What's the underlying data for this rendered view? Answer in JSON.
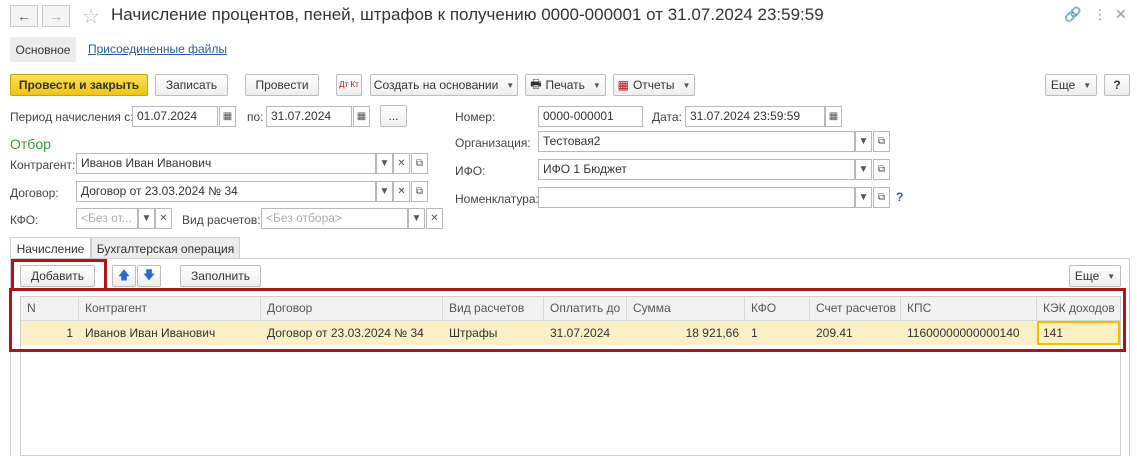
{
  "window": {
    "back_icon": "arrow-left",
    "forward_icon": "arrow-right",
    "title": "Начисление процентов, пеней, штрафов к получению 0000-000001 от 31.07.2024 23:59:59"
  },
  "top_tabs": {
    "main": "Основное",
    "attached": "Присоединенные файлы"
  },
  "toolbar": {
    "post_close": "Провести и закрыть",
    "save": "Записать",
    "post": "Провести",
    "dt_kt": "Дт Кт",
    "create_based": "Создать на основании",
    "print": "Печать",
    "reports": "Отчеты",
    "more": "Еще",
    "help": "?"
  },
  "form": {
    "period_from_label": "Период начисления с:",
    "period_from": "01.07.2024",
    "period_to_label": "по:",
    "period_to": "31.07.2024",
    "ellipsis": "...",
    "number_label": "Номер:",
    "number": "0000-000001",
    "date_label": "Дата:",
    "date": "31.07.2024 23:59:59",
    "filter_title": "Отбор",
    "counterparty_label": "Контрагент:",
    "counterparty": "Иванов Иван Иванович",
    "contract_label": "Договор:",
    "contract": "Договор от 23.03.2024 № 34",
    "kfo_label": "КФО:",
    "kfo_placeholder": "<Без от...",
    "calc_type_label": "Вид расчетов:",
    "calc_type_placeholder": "<Без отбора>",
    "org_label": "Организация:",
    "org": "Тестовая2",
    "ifo_label": "ИФО:",
    "ifo": "ИФО 1 Бюджет",
    "nomenclature_label": "Номенклатура:",
    "nomenclature": "",
    "help_mark": "?"
  },
  "inner_tabs": {
    "accrual": "Начисление",
    "accounting": "Бухгалтерская операция"
  },
  "table_toolbar": {
    "add": "Добавить",
    "fill": "Заполнить",
    "more": "Еще"
  },
  "table": {
    "headers": [
      "N",
      "Контрагент",
      "Договор",
      "Вид расчетов",
      "Оплатить до",
      "Сумма",
      "КФО",
      "Счет расчетов",
      "КПС",
      "КЭК доходов"
    ],
    "rows": [
      [
        "1",
        "Иванов Иван Иванович",
        "Договор от 23.03.2024 № 34",
        "Штрафы",
        "31.07.2024",
        "18 921,66",
        "1",
        "209.41",
        "11600000000000140",
        "141"
      ]
    ]
  },
  "colors": {
    "primary_button": "#f1c40f",
    "highlight": "#b01418",
    "selected_row": "#fbefc6",
    "filter_title": "#3b9a3b"
  }
}
